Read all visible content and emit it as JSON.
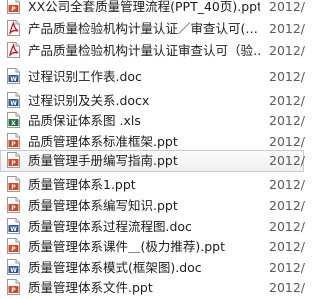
{
  "files": [
    {
      "name": "XX公司全套质量管理流程(PPT_40页).ppt",
      "date": "2012/",
      "icon": "ppt-file-icon",
      "selected": false
    },
    {
      "name": "产品质量检验机构计量认证／审查认可(…",
      "date": "2012/",
      "icon": "pdf-file-icon",
      "selected": false
    },
    {
      "name": "产品质量检验机构计量认证审查认可（验…",
      "date": "2012/",
      "icon": "pdf-file-icon",
      "selected": false
    },
    {
      "name": "过程识别工作表.doc",
      "date": "2012/",
      "icon": "doc-file-icon",
      "selected": false
    },
    {
      "name": "过程识别及关系.docx",
      "date": "2012/",
      "icon": "doc-file-icon",
      "selected": false
    },
    {
      "name": "品质保证体系图 .xls",
      "date": "2012/",
      "icon": "xls-file-icon",
      "selected": false
    },
    {
      "name": "品质管理体系标准框架.ppt",
      "date": "2012/",
      "icon": "ppt-file-icon",
      "selected": false
    },
    {
      "name": "质量管理手册编写指南.ppt",
      "date": "2012/",
      "icon": "ppt-file-icon",
      "selected": true
    },
    {
      "name": "质量管理体系1.ppt",
      "date": "2012/",
      "icon": "ppt-file-icon",
      "selected": false
    },
    {
      "name": "质量管理体系编写知识.ppt",
      "date": "2012/",
      "icon": "ppt-file-icon",
      "selected": false
    },
    {
      "name": "质量管理体系过程流程图.doc",
      "date": "2012/",
      "icon": "doc-file-icon",
      "selected": false
    },
    {
      "name": "质量管理体系课件＿(极力推荐).ppt",
      "date": "2012/",
      "icon": "ppt-file-icon",
      "selected": false
    },
    {
      "name": "质量管理体系模式(框架图).doc",
      "date": "2012/",
      "icon": "doc-file-icon",
      "selected": false
    },
    {
      "name": "质量管理体系文件.ppt",
      "date": "2012/",
      "icon": "ppt-file-icon",
      "selected": false
    }
  ]
}
